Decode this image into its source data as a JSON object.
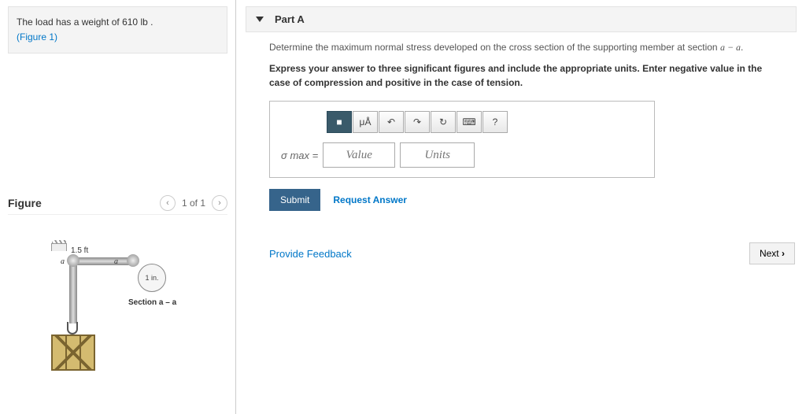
{
  "problem": {
    "statement_prefix": "The load has a weight of 610 ",
    "statement_unit": "lb",
    "statement_suffix": " .",
    "figure_link": "(Figure 1)"
  },
  "figure": {
    "title": "Figure",
    "pager": "1 of 1",
    "dim_horizontal": "1.5 ft",
    "label_a1": "a",
    "label_a2": "a",
    "detail_label": "1 in.",
    "section_label": "Section a – a"
  },
  "partA": {
    "title": "Part A",
    "prompt_prefix": "Determine the maximum normal stress developed on the cross section of the supporting member at section ",
    "prompt_var": "a − a",
    "prompt_suffix": ".",
    "instruction": "Express your answer to three significant figures and include the appropriate units. Enter negative value in the case of compression and positive in the case of tension.",
    "sigma_label": "σ max =",
    "value_placeholder": "Value",
    "units_placeholder": "Units",
    "toolbar": {
      "format_icon": "■",
      "greek": "μÅ",
      "undo": "↶",
      "redo": "↷",
      "reset": "↻",
      "keyboard": "⌨",
      "help": "?"
    },
    "submit": "Submit",
    "request_answer": "Request Answer"
  },
  "footer": {
    "feedback": "Provide Feedback",
    "next": "Next"
  }
}
